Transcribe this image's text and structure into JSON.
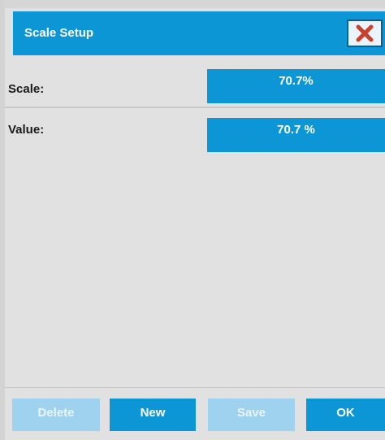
{
  "dialog": {
    "title": "Scale Setup",
    "close_icon": "close-x-icon",
    "colors": {
      "accent": "#0d96d6",
      "disabled": "#9ed2ee",
      "close_x": "#c9412e",
      "background": "#e1e1e1"
    }
  },
  "fields": {
    "scale": {
      "label": "Scale:",
      "value": "70.7%"
    },
    "value": {
      "label": "Value:",
      "value": "70.7 %"
    }
  },
  "buttons": {
    "delete": {
      "label": "Delete",
      "enabled": false
    },
    "new": {
      "label": "New",
      "enabled": true
    },
    "save": {
      "label": "Save",
      "enabled": false
    },
    "ok": {
      "label": "OK",
      "enabled": true
    }
  }
}
